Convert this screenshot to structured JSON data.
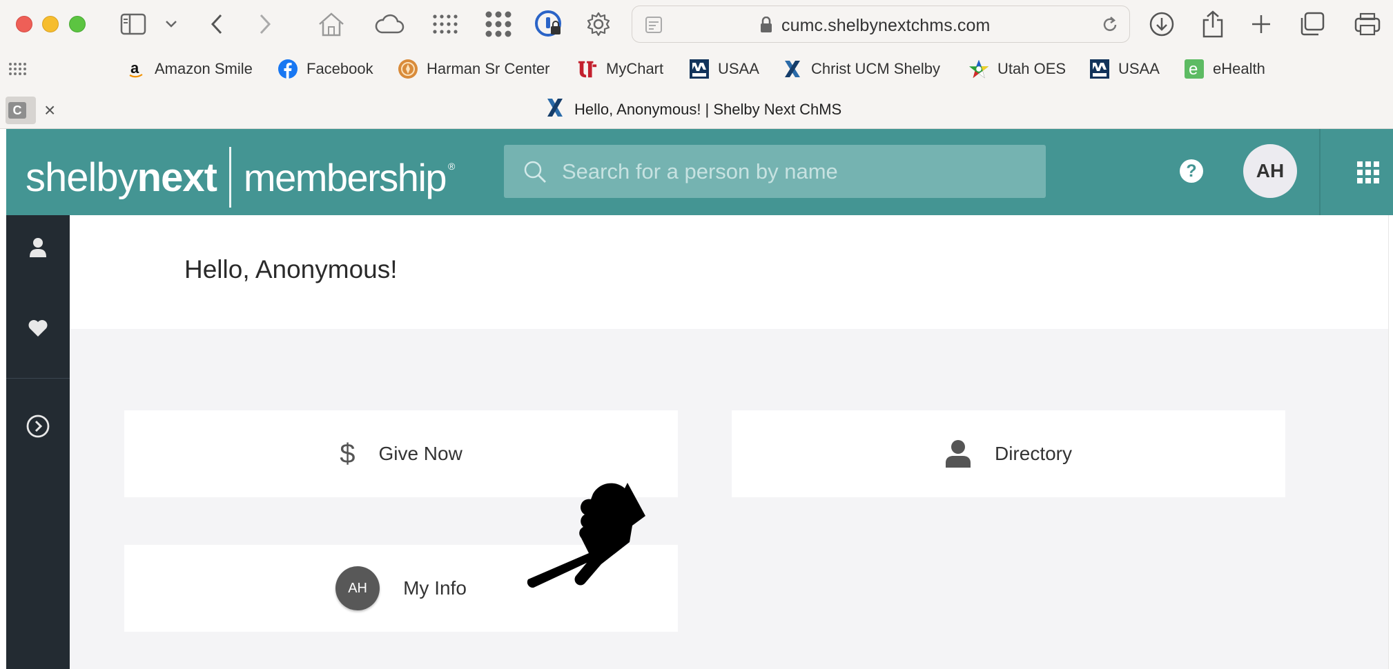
{
  "browser": {
    "url": "cumc.shelbynextchms.com",
    "tab_title": "Hello, Anonymous! | Shelby Next ChMS",
    "pinned_tab_letter": "C",
    "tab_close": "×"
  },
  "bookmarks": [
    {
      "label": "Amazon Smile",
      "icon": "amazon-icon"
    },
    {
      "label": "Facebook",
      "icon": "facebook-icon"
    },
    {
      "label": "Harman Sr Center",
      "icon": "harman-icon"
    },
    {
      "label": "MyChart",
      "icon": "mychart-icon"
    },
    {
      "label": "USAA",
      "icon": "usaa-icon"
    },
    {
      "label": "Christ UCM Shelby",
      "icon": "shelby-x-icon"
    },
    {
      "label": "Utah OES",
      "icon": "oes-star-icon"
    },
    {
      "label": "USAA",
      "icon": "usaa-icon"
    },
    {
      "label": "eHealth",
      "icon": "ehealth-icon"
    }
  ],
  "header": {
    "logo_left": "shelby",
    "logo_bold": "next",
    "logo_right": "membership",
    "logo_reg": "®",
    "search_placeholder": "Search for a person by name",
    "help_label": "?",
    "user_initials": "AH"
  },
  "main": {
    "greeting": "Hello, Anonymous!",
    "cards": {
      "give_now": {
        "label": "Give Now",
        "icon_glyph": "$"
      },
      "directory": {
        "label": "Directory"
      },
      "my_info": {
        "label": "My Info",
        "avatar_initials": "AH"
      }
    }
  },
  "colors": {
    "header_teal": "#449593",
    "sidebar_dark": "#232b32",
    "panel_bg": "#f4f4f6"
  }
}
